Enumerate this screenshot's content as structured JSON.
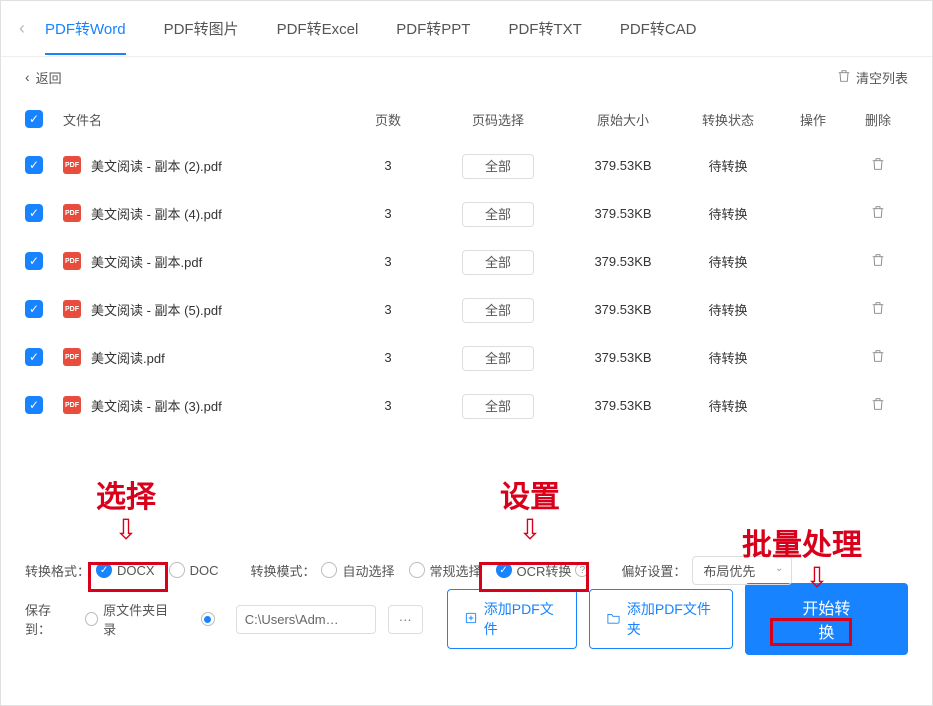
{
  "tabs": {
    "items": [
      {
        "label": "PDF转Word",
        "active": true
      },
      {
        "label": "PDF转图片",
        "active": false
      },
      {
        "label": "PDF转Excel",
        "active": false
      },
      {
        "label": "PDF转PPT",
        "active": false
      },
      {
        "label": "PDF转TXT",
        "active": false
      },
      {
        "label": "PDF转CAD",
        "active": false
      }
    ]
  },
  "subbar": {
    "back": "返回",
    "clear": "清空列表"
  },
  "thead": {
    "name": "文件名",
    "pages": "页数",
    "range": "页码选择",
    "size": "原始大小",
    "status": "转换状态",
    "op": "操作",
    "del": "删除"
  },
  "rows": [
    {
      "name": "美文阅读 - 副本 (2).pdf",
      "pages": "3",
      "range": "全部",
      "size": "379.53KB",
      "status": "待转换"
    },
    {
      "name": "美文阅读 - 副本 (4).pdf",
      "pages": "3",
      "range": "全部",
      "size": "379.53KB",
      "status": "待转换"
    },
    {
      "name": "美文阅读 - 副本.pdf",
      "pages": "3",
      "range": "全部",
      "size": "379.53KB",
      "status": "待转换"
    },
    {
      "name": "美文阅读 - 副本 (5).pdf",
      "pages": "3",
      "range": "全部",
      "size": "379.53KB",
      "status": "待转换"
    },
    {
      "name": "美文阅读.pdf",
      "pages": "3",
      "range": "全部",
      "size": "379.53KB",
      "status": "待转换"
    },
    {
      "name": "美文阅读 - 副本 (3).pdf",
      "pages": "3",
      "range": "全部",
      "size": "379.53KB",
      "status": "待转换"
    }
  ],
  "options": {
    "format_label": "转换格式：",
    "format_docx": "DOCX",
    "format_doc": "DOC",
    "mode_label": "转换模式：",
    "mode_auto": "自动选择",
    "mode_normal": "常规选择",
    "mode_ocr": "OCR转换",
    "pref_label": "偏好设置：",
    "pref_value": "布局优先"
  },
  "actions": {
    "saveto_label": "保存到：",
    "orig_dir": "原文件夹目录",
    "path_value": "C:\\Users\\Adm…",
    "path_browse": "···",
    "add_file": "添加PDF文件",
    "add_folder": "添加PDF文件夹",
    "start": "开始转换"
  },
  "annot": {
    "select": "选择",
    "settings": "设置",
    "batch": "批量处理"
  },
  "pdf_badge": "PDF"
}
